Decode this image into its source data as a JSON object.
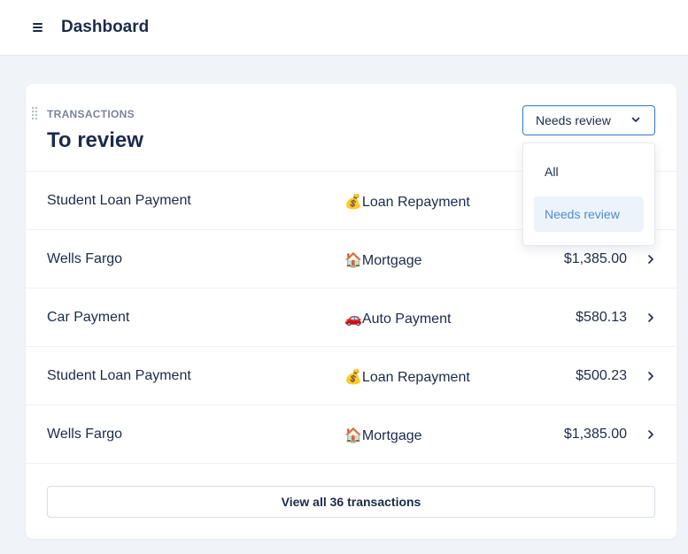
{
  "header": {
    "menu_icon": "hamburger-menu-icon",
    "title": "Dashboard"
  },
  "card": {
    "eyebrow": "TRANSACTIONS",
    "title": "To review",
    "filter": {
      "selected": "Needs review",
      "options": [
        "All",
        "Needs review"
      ]
    },
    "rows": [
      {
        "name": "Student Loan Payment",
        "category": "💰Loan Repayment",
        "amount": ""
      },
      {
        "name": "Wells Fargo",
        "category": "🏠Mortgage",
        "amount": "$1,385.00"
      },
      {
        "name": "Car Payment",
        "category": "🚗Auto Payment",
        "amount": "$580.13"
      },
      {
        "name": "Student Loan Payment",
        "category": "💰Loan Repayment",
        "amount": "$500.23"
      },
      {
        "name": "Wells Fargo",
        "category": "🏠Mortgage",
        "amount": "$1,385.00"
      }
    ],
    "view_all_label": "View all 36 transactions"
  },
  "colors": {
    "accent": "#2f78c4",
    "text": "#1c2b4a",
    "muted": "#7a8599",
    "background": "#f0f3f7",
    "selected_bg": "#edf3fb",
    "selected_text": "#4f8bd0"
  }
}
